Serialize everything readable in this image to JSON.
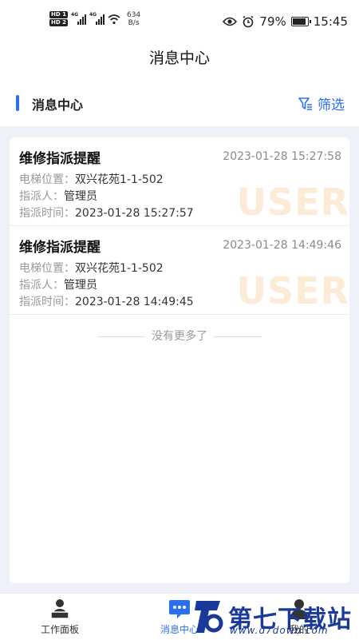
{
  "status": {
    "network_speed_value": "634",
    "network_speed_unit": "B/s",
    "battery": "79%",
    "time": "15:45"
  },
  "nav": {
    "title": "消息中心"
  },
  "section": {
    "title": "消息中心",
    "filter_label": "筛选"
  },
  "messages": [
    {
      "title": "维修指派提醒",
      "time": "2023-01-28 15:27:58",
      "location_label": "电梯位置：",
      "location": "双兴花苑1-1-502",
      "assigner_label": "指派人：",
      "assigner": "管理员",
      "assign_time_label": "指派时间：",
      "assign_time": "2023-01-28 15:27:57",
      "watermark": "USER"
    },
    {
      "title": "维修指派提醒",
      "time": "2023-01-28 14:49:46",
      "location_label": "电梯位置：",
      "location": "双兴花苑1-1-502",
      "assigner_label": "指派人：",
      "assigner": "管理员",
      "assign_time_label": "指派时间：",
      "assign_time": "2023-01-28 14:49:45",
      "watermark": "USER"
    }
  ],
  "list_end": "没有更多了",
  "tabs": [
    {
      "label": "工作面板"
    },
    {
      "label": "消息中心"
    },
    {
      "label": "我的"
    }
  ],
  "brand": {
    "name": "第七下载站",
    "url": "www.d7down.com"
  },
  "colors": {
    "accent": "#2a6ff0",
    "watermark": "#fbebd7",
    "brand": "#1a3a9a"
  },
  "icons": [
    "eye-icon",
    "alarm-icon",
    "battery-icon",
    "wifi-icon",
    "filter-icon",
    "dashboard-icon",
    "chat-icon",
    "user-icon"
  ]
}
